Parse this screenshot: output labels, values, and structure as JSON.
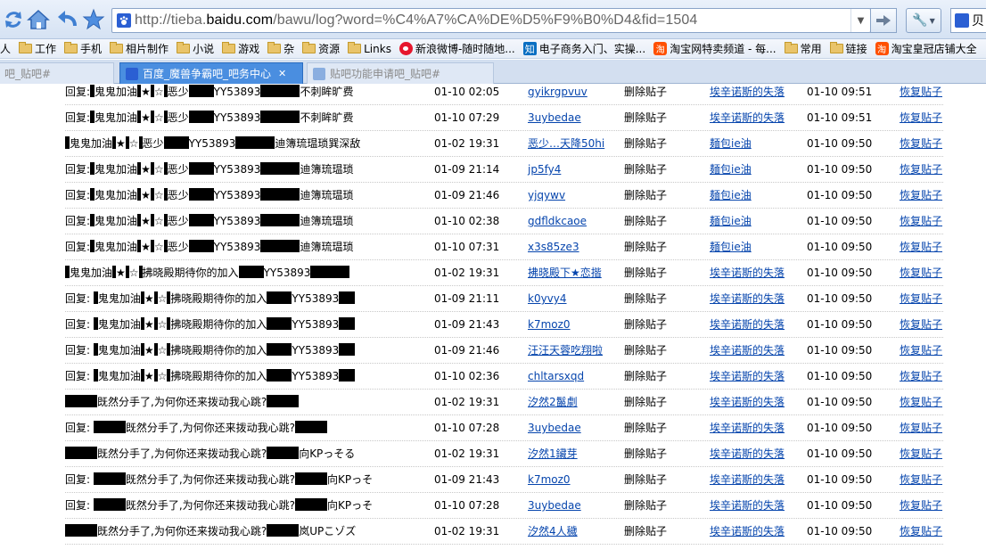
{
  "browser": {
    "url_prefix": "http://tieba.",
    "url_domain": "baidu.com",
    "url_suffix": "/bawu/log?word=%C4%A7%CA%DE%D5%F9%B0%D4&fid=1504",
    "search_partial": "贝"
  },
  "bookmarks": [
    {
      "label": "人",
      "icon": "none"
    },
    {
      "label": "工作",
      "icon": "folder-icon"
    },
    {
      "label": "手机",
      "icon": "folder-icon"
    },
    {
      "label": "相片制作",
      "icon": "folder-icon"
    },
    {
      "label": "小说",
      "icon": "folder-icon"
    },
    {
      "label": "游戏",
      "icon": "folder-icon"
    },
    {
      "label": "杂",
      "icon": "folder-icon"
    },
    {
      "label": "资源",
      "icon": "folder-icon"
    },
    {
      "label": "Links",
      "icon": "folder-icon"
    },
    {
      "label": "新浪微博-随时随地...",
      "icon": "weibo-icon"
    },
    {
      "label": "电子商务入门、实操...",
      "icon": "zhihu-icon"
    },
    {
      "label": "淘宝网特卖频道 - 每...",
      "icon": "taobao-icon"
    },
    {
      "label": "常用",
      "icon": "folder-icon"
    },
    {
      "label": "链接",
      "icon": "folder-icon"
    },
    {
      "label": "淘宝皇冠店铺大全",
      "icon": "taobao-icon"
    }
  ],
  "tabs": [
    {
      "label": "吧_贴吧#",
      "active": false
    },
    {
      "label": "百度_魔兽争霸吧_吧务中心",
      "active": true
    },
    {
      "label": "贴吧功能申请吧_贴吧#",
      "active": false
    }
  ],
  "log_rows": [
    {
      "title": [
        [
          "回复:",
          0
        ],
        [
          "",
          5
        ],
        [
          "鬼鬼加油",
          0
        ],
        [
          "",
          4
        ],
        [
          "★",
          0
        ],
        [
          "",
          4
        ],
        [
          "☆",
          0
        ],
        [
          "",
          4
        ],
        [
          "恶少",
          0
        ],
        [
          "",
          28
        ],
        [
          "YY53893",
          0
        ],
        [
          "",
          44
        ],
        [
          "不刺眸旷费",
          0
        ]
      ],
      "time": "01-10 02:05",
      "user": "gyikrgpvuv",
      "action": "删除贴子",
      "admin": "埃辛诺斯的失落",
      "op_time": "01-10 09:51",
      "restore": "恢复贴子"
    },
    {
      "title": [
        [
          "回复:",
          0
        ],
        [
          "",
          5
        ],
        [
          "鬼鬼加油",
          0
        ],
        [
          "",
          4
        ],
        [
          "★",
          0
        ],
        [
          "",
          4
        ],
        [
          "☆",
          0
        ],
        [
          "",
          4
        ],
        [
          "恶少",
          0
        ],
        [
          "",
          28
        ],
        [
          "YY53893",
          0
        ],
        [
          "",
          44
        ],
        [
          "不刺眸旷费",
          0
        ]
      ],
      "time": "01-10 07:29",
      "user": "3uybedae",
      "action": "删除贴子",
      "admin": "埃辛诺斯的失落",
      "op_time": "01-10 09:51",
      "restore": "恢复贴子"
    },
    {
      "title": [
        [
          "",
          5
        ],
        [
          "鬼鬼加油",
          0
        ],
        [
          "",
          4
        ],
        [
          "★",
          0
        ],
        [
          "",
          4
        ],
        [
          "☆",
          0
        ],
        [
          "",
          4
        ],
        [
          "恶少",
          0
        ],
        [
          "",
          28
        ],
        [
          "YY53893",
          0
        ],
        [
          "",
          44
        ],
        [
          "迪簿琉瑥琐巽深敌",
          0
        ]
      ],
      "time": "01-02 19:31",
      "user": "恶少…天降50hi",
      "action": "删除贴子",
      "admin": "麺包ie油",
      "op_time": "01-10 09:50",
      "restore": "恢复贴子"
    },
    {
      "title": [
        [
          "回复:",
          0
        ],
        [
          "",
          5
        ],
        [
          "鬼鬼加油",
          0
        ],
        [
          "",
          4
        ],
        [
          "★",
          0
        ],
        [
          "",
          4
        ],
        [
          "☆",
          0
        ],
        [
          "",
          4
        ],
        [
          "恶少",
          0
        ],
        [
          "",
          28
        ],
        [
          "YY53893",
          0
        ],
        [
          "",
          44
        ],
        [
          "迪簿琉瑥琐",
          0
        ]
      ],
      "time": "01-09 21:14",
      "user": "jp5fy4",
      "action": "删除贴子",
      "admin": "麺包ie油",
      "op_time": "01-10 09:50",
      "restore": "恢复贴子"
    },
    {
      "title": [
        [
          "回复:",
          0
        ],
        [
          "",
          5
        ],
        [
          "鬼鬼加油",
          0
        ],
        [
          "",
          4
        ],
        [
          "★",
          0
        ],
        [
          "",
          4
        ],
        [
          "☆",
          0
        ],
        [
          "",
          4
        ],
        [
          "恶少",
          0
        ],
        [
          "",
          28
        ],
        [
          "YY53893",
          0
        ],
        [
          "",
          44
        ],
        [
          "迪簿琉瑥琐",
          0
        ]
      ],
      "time": "01-09 21:46",
      "user": "yjqywv",
      "action": "删除贴子",
      "admin": "麺包ie油",
      "op_time": "01-10 09:50",
      "restore": "恢复贴子"
    },
    {
      "title": [
        [
          "回复:",
          0
        ],
        [
          "",
          5
        ],
        [
          "鬼鬼加油",
          0
        ],
        [
          "",
          4
        ],
        [
          "★",
          0
        ],
        [
          "",
          4
        ],
        [
          "☆",
          0
        ],
        [
          "",
          4
        ],
        [
          "恶少",
          0
        ],
        [
          "",
          28
        ],
        [
          "YY53893",
          0
        ],
        [
          "",
          44
        ],
        [
          "迪簿琉瑥琐",
          0
        ]
      ],
      "time": "01-10 02:38",
      "user": "gdfldkcaoe",
      "action": "删除贴子",
      "admin": "麺包ie油",
      "op_time": "01-10 09:50",
      "restore": "恢复贴子"
    },
    {
      "title": [
        [
          "回复:",
          0
        ],
        [
          "",
          5
        ],
        [
          "鬼鬼加油",
          0
        ],
        [
          "",
          4
        ],
        [
          "★",
          0
        ],
        [
          "",
          4
        ],
        [
          "☆",
          0
        ],
        [
          "",
          4
        ],
        [
          "恶少",
          0
        ],
        [
          "",
          28
        ],
        [
          "YY53893",
          0
        ],
        [
          "",
          44
        ],
        [
          "迪簿琉瑥琐",
          0
        ]
      ],
      "time": "01-10 07:31",
      "user": "x3s85ze3",
      "action": "删除贴子",
      "admin": "麺包ie油",
      "op_time": "01-10 09:50",
      "restore": "恢复贴子"
    },
    {
      "title": [
        [
          "",
          5
        ],
        [
          "鬼鬼加油",
          0
        ],
        [
          "",
          4
        ],
        [
          "★",
          0
        ],
        [
          "",
          4
        ],
        [
          "☆",
          0
        ],
        [
          "",
          4
        ],
        [
          "拂晓殿期待你的加入",
          0
        ],
        [
          "",
          28
        ],
        [
          "YY53893",
          0
        ],
        [
          "",
          44
        ]
      ],
      "time": "01-02 19:31",
      "user": "拂晓殿下★恋揩",
      "action": "删除贴子",
      "admin": "埃辛诺斯的失落",
      "op_time": "01-10 09:50",
      "restore": "恢复贴子"
    },
    {
      "title": [
        [
          "回复: ",
          0
        ],
        [
          "",
          5
        ],
        [
          "鬼鬼加油",
          0
        ],
        [
          "",
          4
        ],
        [
          "★",
          0
        ],
        [
          "",
          4
        ],
        [
          "☆",
          0
        ],
        [
          "",
          4
        ],
        [
          "拂晓殿期待你的加入",
          0
        ],
        [
          "",
          28
        ],
        [
          "YY53893",
          0
        ],
        [
          "",
          18
        ]
      ],
      "time": "01-09 21:11",
      "user": "k0yvy4",
      "action": "删除贴子",
      "admin": "埃辛诺斯的失落",
      "op_time": "01-10 09:50",
      "restore": "恢复贴子"
    },
    {
      "title": [
        [
          "回复: ",
          0
        ],
        [
          "",
          5
        ],
        [
          "鬼鬼加油",
          0
        ],
        [
          "",
          4
        ],
        [
          "★",
          0
        ],
        [
          "",
          4
        ],
        [
          "☆",
          0
        ],
        [
          "",
          4
        ],
        [
          "拂晓殿期待你的加入",
          0
        ],
        [
          "",
          28
        ],
        [
          "YY53893",
          0
        ],
        [
          "",
          18
        ]
      ],
      "time": "01-09 21:43",
      "user": "k7moz0",
      "action": "删除贴子",
      "admin": "埃辛诺斯的失落",
      "op_time": "01-10 09:50",
      "restore": "恢复贴子"
    },
    {
      "title": [
        [
          "回复: ",
          0
        ],
        [
          "",
          5
        ],
        [
          "鬼鬼加油",
          0
        ],
        [
          "",
          4
        ],
        [
          "★",
          0
        ],
        [
          "",
          4
        ],
        [
          "☆",
          0
        ],
        [
          "",
          4
        ],
        [
          "拂晓殿期待你的加入",
          0
        ],
        [
          "",
          28
        ],
        [
          "YY53893",
          0
        ],
        [
          "",
          18
        ]
      ],
      "time": "01-09 21:46",
      "user": "汪汪天蓉吃翔啦",
      "action": "删除贴子",
      "admin": "埃辛诺斯的失落",
      "op_time": "01-10 09:50",
      "restore": "恢复贴子"
    },
    {
      "title": [
        [
          "回复: ",
          0
        ],
        [
          "",
          5
        ],
        [
          "鬼鬼加油",
          0
        ],
        [
          "",
          4
        ],
        [
          "★",
          0
        ],
        [
          "",
          4
        ],
        [
          "☆",
          0
        ],
        [
          "",
          4
        ],
        [
          "拂晓殿期待你的加入",
          0
        ],
        [
          "",
          28
        ],
        [
          "YY53893",
          0
        ],
        [
          "",
          18
        ]
      ],
      "time": "01-10 02:36",
      "user": "chltarsxqd",
      "action": "删除贴子",
      "admin": "埃辛诺斯的失落",
      "op_time": "01-10 09:50",
      "restore": "恢复贴子"
    },
    {
      "title": [
        [
          "",
          36
        ],
        [
          "既然分手了,为何你还来拨动我心跳?",
          0
        ],
        [
          "",
          36
        ]
      ],
      "time": "01-02 19:31",
      "user": "汐然2鬣劇",
      "action": "删除贴子",
      "admin": "埃辛诺斯的失落",
      "op_time": "01-10 09:50",
      "restore": "恢复贴子"
    },
    {
      "title": [
        [
          "回复: ",
          0
        ],
        [
          "",
          36
        ],
        [
          "既然分手了,为何你还来拨动我心跳?",
          0
        ],
        [
          "",
          36
        ]
      ],
      "time": "01-10 07:28",
      "user": "3uybedae",
      "action": "删除贴子",
      "admin": "埃辛诺斯的失落",
      "op_time": "01-10 09:50",
      "restore": "恢复贴子"
    },
    {
      "title": [
        [
          "",
          36
        ],
        [
          "既然分手了,为何你还来拨动我心跳?",
          0
        ],
        [
          "",
          36
        ],
        [
          "向KPっそる",
          0
        ]
      ],
      "time": "01-02 19:31",
      "user": "汐然1鑶芽",
      "action": "删除贴子",
      "admin": "埃辛诺斯的失落",
      "op_time": "01-10 09:50",
      "restore": "恢复贴子"
    },
    {
      "title": [
        [
          "回复: ",
          0
        ],
        [
          "",
          36
        ],
        [
          "既然分手了,为何你还来拨动我心跳?",
          0
        ],
        [
          "",
          36
        ],
        [
          "向KPっそ",
          0
        ]
      ],
      "time": "01-09 21:43",
      "user": "k7moz0",
      "action": "删除贴子",
      "admin": "埃辛诺斯的失落",
      "op_time": "01-10 09:50",
      "restore": "恢复贴子"
    },
    {
      "title": [
        [
          "回复: ",
          0
        ],
        [
          "",
          36
        ],
        [
          "既然分手了,为何你还来拨动我心跳?",
          0
        ],
        [
          "",
          36
        ],
        [
          "向KPっそ",
          0
        ]
      ],
      "time": "01-10 07:28",
      "user": "3uybedae",
      "action": "删除贴子",
      "admin": "埃辛诺斯的失落",
      "op_time": "01-10 09:50",
      "restore": "恢复贴子"
    },
    {
      "title": [
        [
          "",
          36
        ],
        [
          "既然分手了,为何你还来拨动我心跳?",
          0
        ],
        [
          "",
          36
        ],
        [
          "岚UPこゾズ",
          0
        ]
      ],
      "time": "01-02 19:31",
      "user": "汐然4人穢",
      "action": "删除贴子",
      "admin": "埃辛诺斯的失落",
      "op_time": "01-10 09:50",
      "restore": "恢复贴子"
    }
  ]
}
